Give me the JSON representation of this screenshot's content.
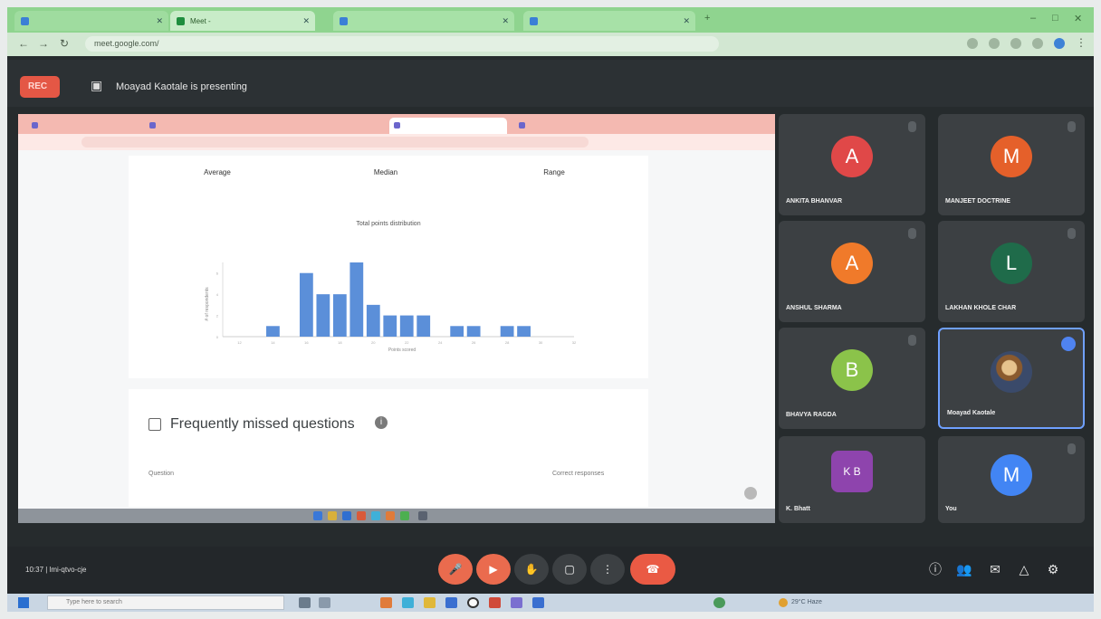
{
  "browser": {
    "tabs": [
      "",
      "Meet - ",
      "",
      ""
    ],
    "url": "meet.google.com/"
  },
  "meet": {
    "rec_label": "REC",
    "presenting_text": "Moayad Kaotale is presenting",
    "meeting_info": "10:37 | lmi-qtvo-cje"
  },
  "shared_screen": {
    "stats": [
      {
        "title": "Average",
        "value": ""
      },
      {
        "title": "Median",
        "value": ""
      },
      {
        "title": "Range",
        "value": ""
      }
    ],
    "chart_title": "Total points distribution",
    "xlabel": "Points scored",
    "ylabel": "# of respondents",
    "section_title": "Frequently missed questions",
    "col_question": "Question",
    "col_correct": "Correct responses",
    "question_row": "",
    "question_value": ""
  },
  "chart_data": {
    "type": "bar",
    "title": "Total points distribution",
    "xlabel": "Points scored",
    "ylabel": "# of respondents",
    "x": [
      14,
      15,
      16,
      17,
      18,
      19,
      20,
      21,
      22,
      23,
      24,
      25,
      26,
      27,
      28,
      29
    ],
    "values": [
      1,
      0,
      6,
      4,
      4,
      7,
      3,
      2,
      2,
      2,
      0,
      1,
      1,
      0,
      1,
      1
    ],
    "ylim": [
      0,
      7
    ]
  },
  "participants": [
    {
      "initial": "A",
      "name": "ANKITA BHANVAR",
      "color": "#e04848"
    },
    {
      "initial": "M",
      "name": "MANJEET DOCTRINE",
      "color": "#e5602a"
    },
    {
      "initial": "A",
      "name": "ANSHUL SHARMA",
      "color": "#f07a2a"
    },
    {
      "initial": "L",
      "name": "LAKHAN KHOLE CHAR",
      "color": "#1f6b4a"
    },
    {
      "initial": "B",
      "name": "BHAVYA RAGDA",
      "color": "#8bc34a"
    },
    {
      "initial": "",
      "name": "Moayad Kaotale",
      "color": "#5a4a3a"
    },
    {
      "initial": "K B",
      "name": "K. Bhatt",
      "color": "#8e44ad"
    },
    {
      "initial": "M",
      "name": "You",
      "color": "#4285f4"
    }
  ],
  "taskbar": {
    "search_placeholder": "Type here to search",
    "tray_text": "29°C Haze"
  },
  "colors": {
    "bar": "#5b8fd9",
    "accent": "#8ab4f8"
  }
}
